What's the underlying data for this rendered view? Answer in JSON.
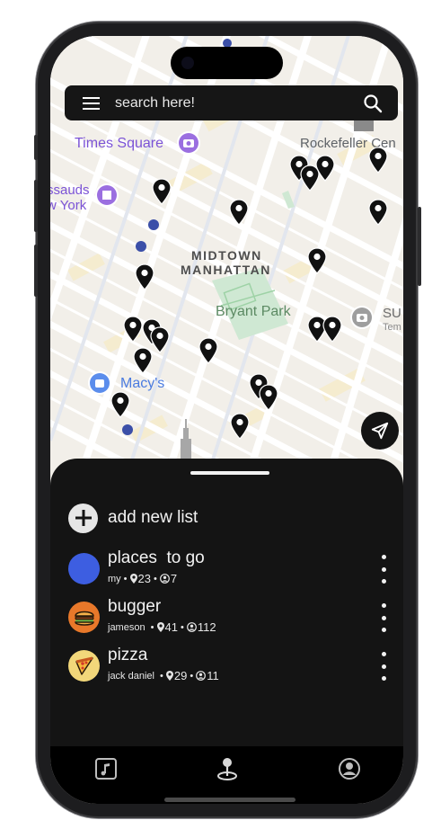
{
  "search": {
    "placeholder": "search here!"
  },
  "map": {
    "labels": {
      "times_square": "Times Square",
      "rockefeller": "Rockefeller Cen",
      "madame": "ssauds",
      "york": "w York",
      "midtown": "MIDTOWN",
      "manhattan": "MANHATTAN",
      "bryant_park": "Bryant Park",
      "macys": "Macy's",
      "su": "SU",
      "tem": "Tem"
    },
    "marker_count": 22
  },
  "sheet": {
    "add_list_label": "add new list",
    "lists": [
      {
        "title": "places  to go",
        "owner": "my",
        "places": "23",
        "followers": "7",
        "avatar": "blue-circle",
        "color": "#3d5ee1"
      },
      {
        "title": "bugger",
        "owner": "jameson ",
        "places": "41",
        "followers": "112",
        "avatar": "burger-icon",
        "color": "#e8782a"
      },
      {
        "title": "pizza",
        "owner": "jack daniel ",
        "places": "29",
        "followers": "11",
        "avatar": "pizza-icon",
        "color": "#f2d77a"
      }
    ]
  },
  "tabs": [
    "music-icon",
    "map-pin-icon",
    "profile-icon"
  ]
}
